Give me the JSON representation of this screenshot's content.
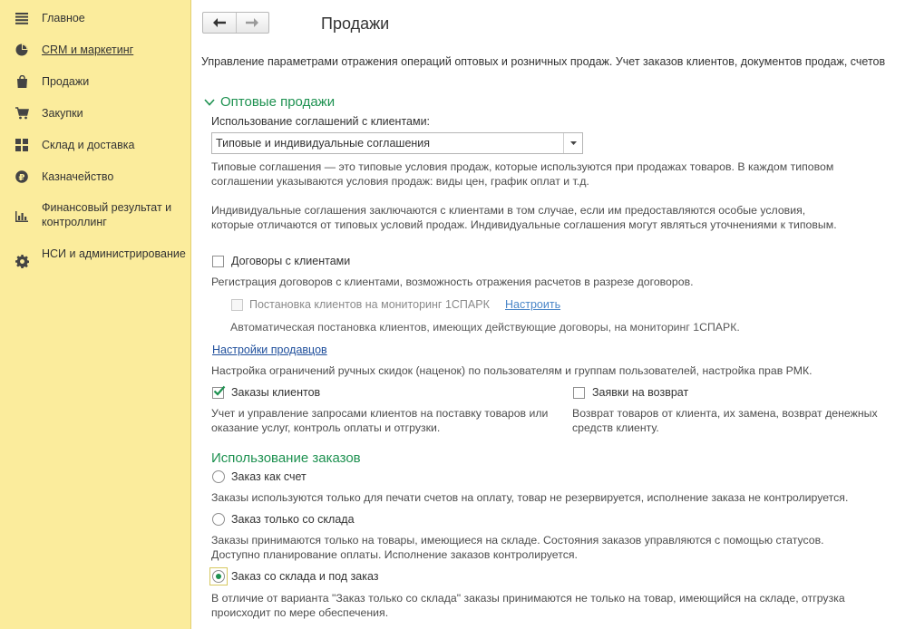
{
  "sidebar": {
    "items": [
      {
        "label": "Главное",
        "icon": "menu-icon"
      },
      {
        "label": "CRM и маркетинг",
        "icon": "pie-chart-icon"
      },
      {
        "label": "Продажи",
        "icon": "shopping-bag-icon"
      },
      {
        "label": "Закупки",
        "icon": "cart-icon"
      },
      {
        "label": "Склад и доставка",
        "icon": "grid-icon"
      },
      {
        "label": "Казначейство",
        "icon": "ruble-icon"
      },
      {
        "label": "Финансовый результат и контроллинг",
        "icon": "bar-chart-icon"
      },
      {
        "label": "НСИ и администрирование",
        "icon": "gear-icon"
      }
    ]
  },
  "header": {
    "title": "Продажи",
    "description": "Управление параметрами отражения операций оптовых и розничных продаж. Учет заказов клиентов, документов продаж, счетов"
  },
  "wholesale": {
    "title": "Оптовые продажи",
    "agreements_label": "Использование соглашений с клиентами:",
    "agreements_value": "Типовые и индивидуальные соглашения",
    "agreements_note1": "Типовые соглашения — это типовые условия продаж, которые используются при продажах товаров. В каждом типовом соглашении указываются условия продаж: виды цен, график оплат и т.д.",
    "agreements_note2": "Индивидуальные соглашения заключаются с клиентами в том случае, если им предоставляются особые условия, которые отличаются от типовых условий продаж. Индивидуальные соглашения могут являться уточнениями к типовым.",
    "contracts_label": "Договоры с клиентами",
    "contracts_checked": false,
    "contracts_note": "Регистрация договоров с клиентами, возможность отражения расчетов в разрезе договоров.",
    "monitoring_label": "Постановка клиентов на мониторинг 1СПАРК",
    "monitoring_link": "Настроить",
    "monitoring_note": "Автоматическая постановка клиентов, имеющих действующие договоры, на мониторинг 1СПАРК.",
    "sellers_link": "Настройки продавцов",
    "sellers_note": "Настройка ограничений ручных скидок (наценок) по пользователям и группам пользователей, настройка прав РМК.",
    "orders_label": "Заказы клиентов",
    "orders_checked": true,
    "orders_note": "Учет и управление запросами клиентов на поставку товаров или оказание услуг, контроль оплаты и отгрузки.",
    "returns_label": "Заявки на возврат",
    "returns_checked": false,
    "returns_note": "Возврат товаров от клиента, их замена, возврат денежных средств клиенту."
  },
  "orders_usage": {
    "title": "Использование заказов",
    "options": [
      {
        "label": "Заказ как счет",
        "note": "Заказы используются только для печати счетов на оплату, товар не резервируется, исполнение заказа не контролируется."
      },
      {
        "label": "Заказ только со склада",
        "note": "Заказы принимаются только на товары, имеющиеся на складе. Состояния заказов управляются с помощью статусов. Доступно планирование оплаты. Исполнение заказов контролируется."
      },
      {
        "label": "Заказ со склада и под заказ",
        "note": "В отличие от варианта \"Заказ только со склада\" заказы принимаются не только на товар, имеющийся на складе, отгрузка происходит по мере обеспечения."
      }
    ],
    "selected": "Заказ со склада и под заказ"
  },
  "colors": {
    "sidebar_bg": "#fbec9c",
    "accent_green": "#1d9150",
    "link_blue": "#1f4f9c"
  }
}
